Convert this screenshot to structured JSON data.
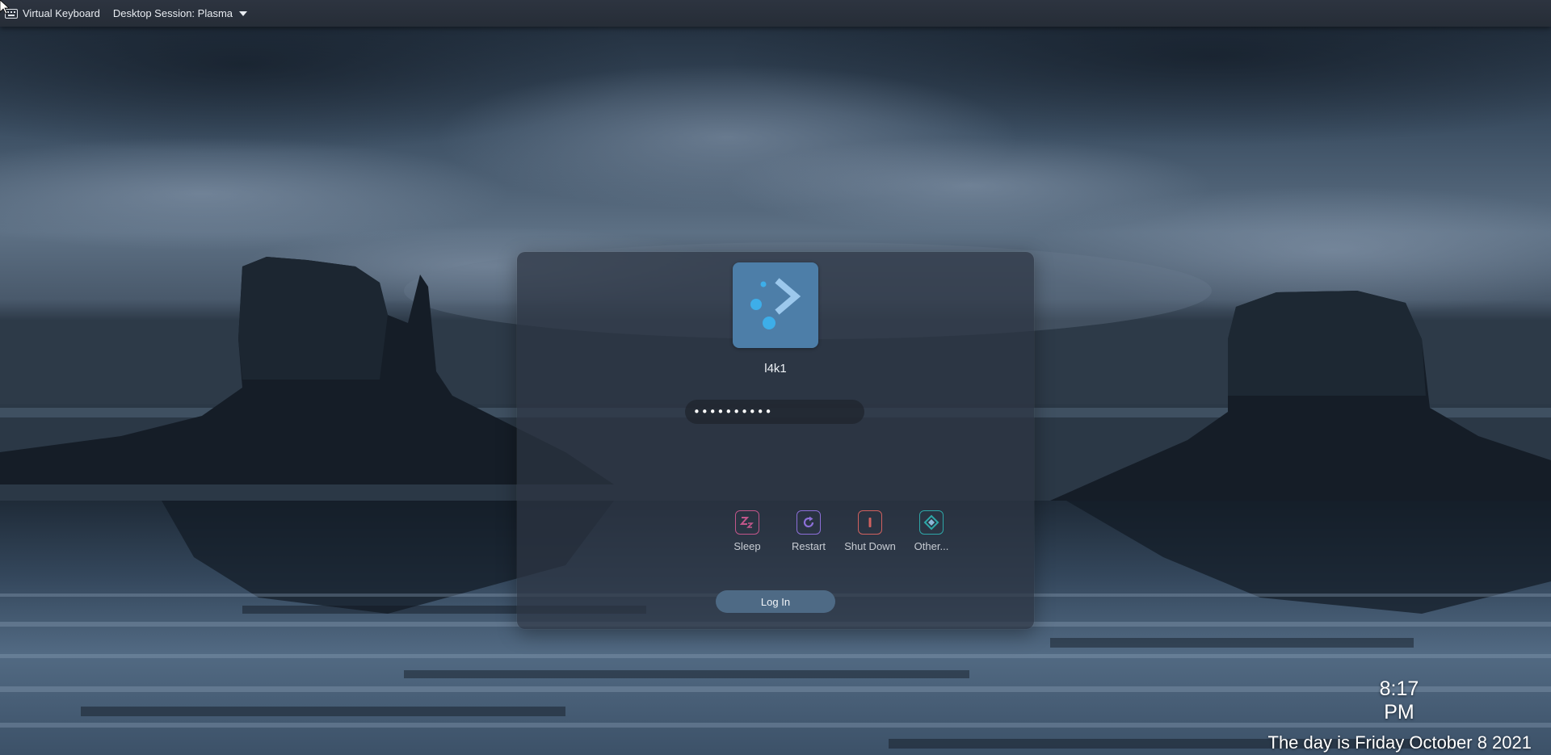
{
  "topbar": {
    "virtual_keyboard_label": "Virtual Keyboard",
    "session_label": "Desktop Session: Plasma"
  },
  "login": {
    "username": "l4k1",
    "password_value": "••••••••••",
    "login_button_label": "Log In",
    "actions": [
      {
        "label": "Sleep",
        "icon": "sleep-icon",
        "color": "#c1568a"
      },
      {
        "label": "Restart",
        "icon": "restart-icon",
        "color": "#8c6fd8"
      },
      {
        "label": "Shut Down",
        "icon": "shutdown-icon",
        "color": "#d0615f"
      },
      {
        "label": "Other...",
        "icon": "other-icon",
        "color": "#2ea7a8"
      }
    ],
    "avatar_color": "#4d7ea8"
  },
  "clock": {
    "time": "8:17 PM",
    "date": "The day is Friday October 8 2021"
  },
  "colors": {
    "accent": "#3daee9",
    "panel": "#2d3442",
    "topbar": "#2a313c"
  }
}
